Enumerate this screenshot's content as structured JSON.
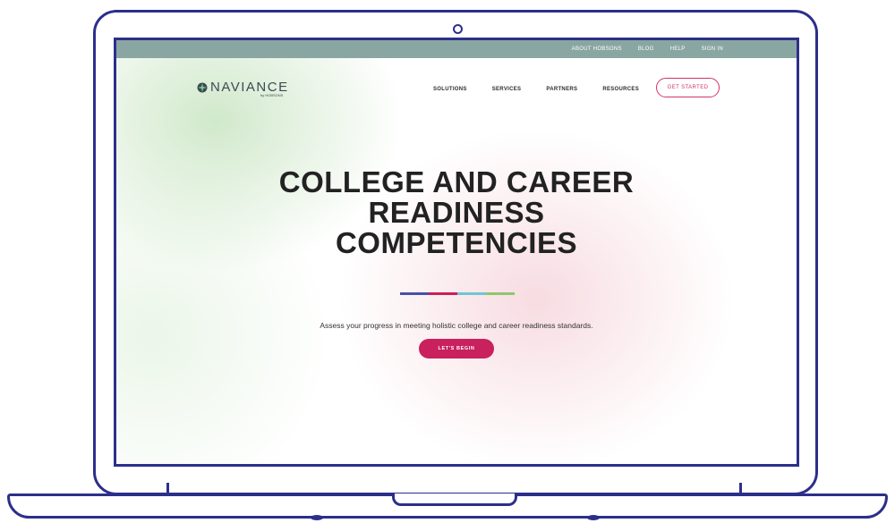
{
  "topbar": {
    "links": [
      "ABOUT HOBSONS",
      "BLOG",
      "HELP",
      "SIGN IN"
    ]
  },
  "logo": {
    "wordmark": "NAVIANCE",
    "subtext": "by HOBSONS",
    "icon": "compass-star-icon"
  },
  "nav": {
    "items": [
      "SOLUTIONS",
      "SERVICES",
      "PARTNERS",
      "RESOURCES"
    ],
    "cta_label": "GET STARTED"
  },
  "hero": {
    "title_lines": [
      "COLLEGE AND CAREER",
      "READINESS",
      "COMPETENCIES"
    ],
    "subtitle": "Assess your progress in meeting holistic college and career readiness standards.",
    "button_label": "LET'S BEGIN"
  },
  "colors": {
    "frame": "#2c2f8a",
    "topbar": "#8aa6a2",
    "accent": "#c9205e",
    "divider": [
      "#4a4fa8",
      "#c9205e",
      "#6fc6d2",
      "#8cc86e"
    ]
  }
}
